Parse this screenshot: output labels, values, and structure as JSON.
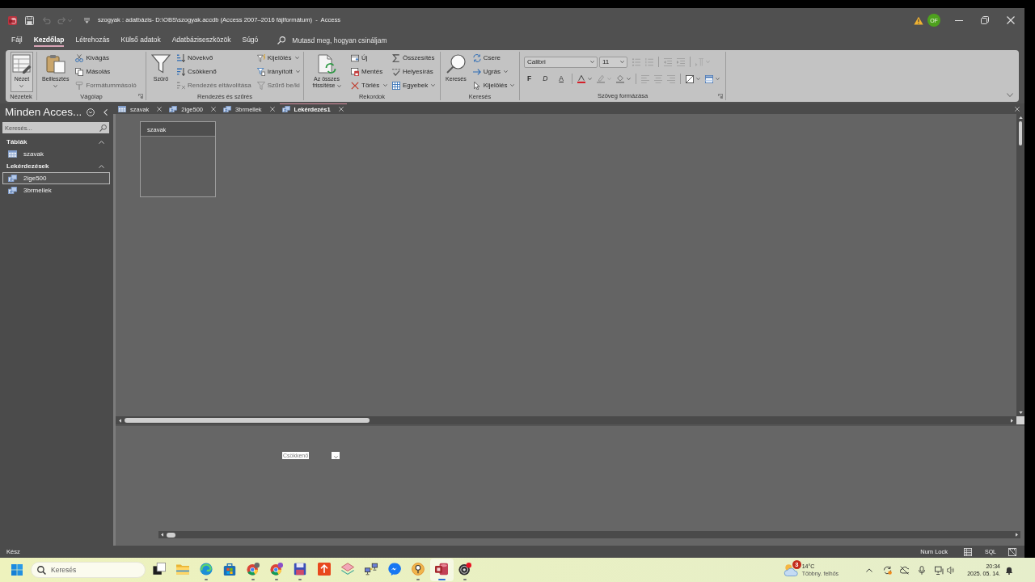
{
  "window": {
    "title": "szogyak : adatbázis- D:\\OBS\\szogyak.accdb (Access 2007–2016 fájlformátum)  -  Access",
    "account_initials": "OF"
  },
  "ribbon_tabs": [
    {
      "label": "Fájl",
      "selected": false
    },
    {
      "label": "Kezdőlap",
      "selected": true
    },
    {
      "label": "Létrehozás",
      "selected": false
    },
    {
      "label": "Külső adatok",
      "selected": false
    },
    {
      "label": "Adatbáziseszközök",
      "selected": false
    },
    {
      "label": "Súgó",
      "selected": false
    }
  ],
  "tell_me": {
    "placeholder": "Mutasd meg, hogyan csináljam"
  },
  "ribbon_groups": [
    {
      "label": "Nézetek",
      "kind": "commands",
      "launcher": false,
      "large": {
        "label": "Nézet",
        "dropdown": true,
        "disabled": false,
        "highlighted": true
      }
    },
    {
      "label": "Vágólap",
      "kind": "commands",
      "launcher": true,
      "large": {
        "label": "Beillesztés",
        "dropdown": true,
        "disabled": false,
        "highlighted": false
      },
      "columns": [
        [
          {
            "label": "Kivágás",
            "dropdown": false,
            "disabled": false
          },
          {
            "label": "Másolás",
            "dropdown": false,
            "disabled": false
          },
          {
            "label": "Formátummásoló",
            "dropdown": false,
            "disabled": true
          }
        ]
      ]
    },
    {
      "label": "Rendezés és szűrés",
      "kind": "commands",
      "launcher": false,
      "large": {
        "label": "Szűrő",
        "dropdown": false,
        "disabled": false,
        "highlighted": false
      },
      "columns": [
        [
          {
            "label": "Növekvő",
            "dropdown": false,
            "disabled": false
          },
          {
            "label": "Csökkenő",
            "dropdown": false,
            "disabled": false
          },
          {
            "label": "Rendezés eltávolítása",
            "dropdown": false,
            "disabled": true
          }
        ],
        [
          {
            "label": "Kijelölés",
            "dropdown": true,
            "disabled": false
          },
          {
            "label": "Irányított",
            "dropdown": true,
            "disabled": false
          },
          {
            "label": "Szűrő be/ki",
            "dropdown": false,
            "disabled": true
          }
        ]
      ]
    },
    {
      "label": "Rekordok",
      "kind": "commands",
      "launcher": false,
      "large": {
        "label": "Az összes frissítése",
        "dropdown": true,
        "disabled": false,
        "highlighted": false
      },
      "columns": [
        [
          {
            "label": "Új",
            "dropdown": false,
            "disabled": false
          },
          {
            "label": "Mentés",
            "dropdown": false,
            "disabled": false
          },
          {
            "label": "Törlés",
            "dropdown": true,
            "disabled": false
          }
        ],
        [
          {
            "label": "Összesítés",
            "dropdown": false,
            "disabled": false
          },
          {
            "label": "Helyesírás",
            "dropdown": false,
            "disabled": false
          },
          {
            "label": "Egyebek",
            "dropdown": true,
            "disabled": false
          }
        ]
      ]
    },
    {
      "label": "Keresés",
      "kind": "commands",
      "launcher": false,
      "large": {
        "label": "Keresés",
        "dropdown": false,
        "disabled": false,
        "highlighted": false
      },
      "columns": [
        [
          {
            "label": "Csere",
            "dropdown": false,
            "disabled": false
          },
          {
            "label": "Ugrás",
            "dropdown": true,
            "disabled": false
          },
          {
            "label": "Kijelölés",
            "dropdown": true,
            "disabled": false
          }
        ]
      ]
    },
    {
      "label": "Szöveg formázása",
      "kind": "formatting",
      "launcher": true,
      "font": "Calibri",
      "font_size": "11",
      "style_buttons": [
        {
          "label": "F",
          "kind": "bold"
        },
        {
          "label": "D",
          "kind": "italic"
        },
        {
          "label": "A",
          "kind": "underline"
        }
      ]
    }
  ],
  "navigation_pane": {
    "title": "Minden Acces...",
    "search": {
      "placeholder": "Keresés..."
    },
    "groups": [
      {
        "label": "Táblák",
        "expanded": true,
        "items": [
          {
            "label": "szavak",
            "kind": "table",
            "selected": false
          }
        ]
      },
      {
        "label": "Lekérdezések",
        "expanded": true,
        "items": [
          {
            "label": "2ige500",
            "kind": "query",
            "selected": true
          },
          {
            "label": "3brmellek",
            "kind": "query",
            "selected": false
          }
        ]
      }
    ]
  },
  "document_tabs": [
    {
      "label": "szavak",
      "kind": "table",
      "selected": false
    },
    {
      "label": "2ige500",
      "kind": "query",
      "selected": false
    },
    {
      "label": "3brmellek",
      "kind": "query",
      "selected": false
    },
    {
      "label": "Lekérdezés1",
      "kind": "query",
      "selected": true
    }
  ],
  "query_design": {
    "tables": [
      {
        "title": "szavak"
      }
    ],
    "grid": {
      "cell": "Csökkenő"
    }
  },
  "status_bar": {
    "text": "Kész",
    "indicator": "Num Lock",
    "view_buttons": [
      {
        "kind": "datasheet"
      },
      {
        "kind": "sql",
        "label": "SQL"
      },
      {
        "kind": "design"
      }
    ]
  },
  "taskbar": {
    "search": {
      "placeholder": "Keresés"
    },
    "apps": [
      {
        "running": false,
        "selected": false
      },
      {
        "running": false,
        "selected": false
      },
      {
        "running": true,
        "selected": false
      },
      {
        "running": false,
        "selected": false
      },
      {
        "running": true,
        "selected": false
      },
      {
        "running": true,
        "selected": false
      },
      {
        "running": true,
        "selected": false
      },
      {
        "running": false,
        "selected": false
      },
      {
        "running": false,
        "selected": false
      },
      {
        "running": false,
        "selected": false
      },
      {
        "running": false,
        "selected": false
      },
      {
        "running": true,
        "selected": false
      },
      {
        "running": true,
        "selected": true
      },
      {
        "running": true,
        "selected": false
      }
    ],
    "weather": {
      "badge": "3",
      "temperature": "14°C",
      "condition": "Többny. felhős"
    },
    "clock": {
      "time": "20:34",
      "date": "2025. 05. 14."
    }
  }
}
